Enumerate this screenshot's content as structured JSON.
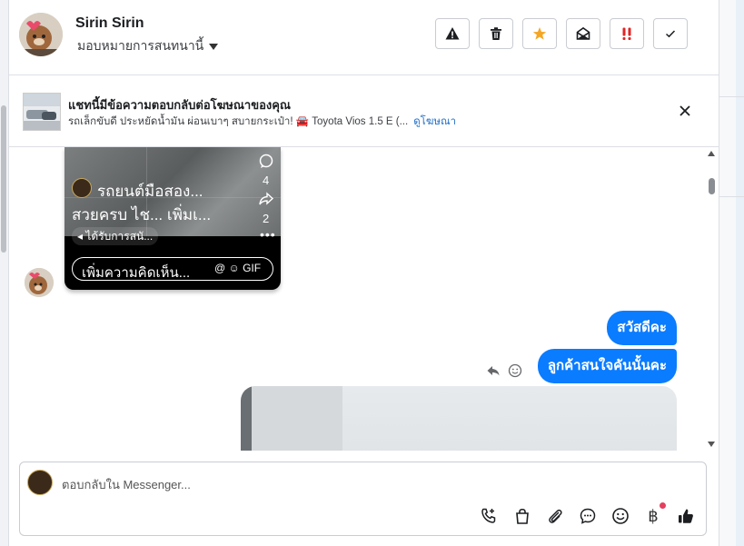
{
  "header": {
    "contact_name": "Sirin Sirin",
    "assign_label": "มอบหมายการสนทนานี้",
    "toolbar": [
      {
        "name": "report-button",
        "icon": "warning-icon"
      },
      {
        "name": "delete-button",
        "icon": "trash-icon"
      },
      {
        "name": "star-button",
        "icon": "star-icon"
      },
      {
        "name": "mark-unread-button",
        "icon": "envelope-open-icon"
      },
      {
        "name": "urgent-button",
        "icon": "double-exclamation-icon"
      },
      {
        "name": "done-button",
        "icon": "check-icon"
      }
    ]
  },
  "banner": {
    "title": "แชทนี้มีข้อความตอบกลับต่อโฆษณาของคุณ",
    "subtitle": "รถเล็กขับดี ประหยัดน้ำมัน ผ่อนเบาๆ สบายกระเป๋า! 🚘 Toyota Vios 1.5 E (...",
    "link": "ดูโฆษณา"
  },
  "post": {
    "author": "รถยนต์มือสอง...",
    "caption": "สวยครบ ไช... เพิ่มเ...",
    "sponsored": "ได้รับการสนั...",
    "comments_count": "4",
    "shares_count": "2",
    "more": "•••",
    "comment_placeholder": "เพิ่มความคิดเห็น...",
    "comment_icons": "@ ☺ GIF"
  },
  "messages": [
    {
      "text": "สวัสดีคะ",
      "direction": "outgoing"
    },
    {
      "text": "ลูกค้าสนใจคันนั้นคะ",
      "direction": "outgoing"
    }
  ],
  "composer": {
    "placeholder": "ตอบกลับใน Messenger...",
    "baht_symbol": "฿"
  },
  "colors": {
    "accent": "#0a7cff",
    "star": "#f5a623",
    "urgent": "#e02424",
    "link": "#2270c9"
  }
}
